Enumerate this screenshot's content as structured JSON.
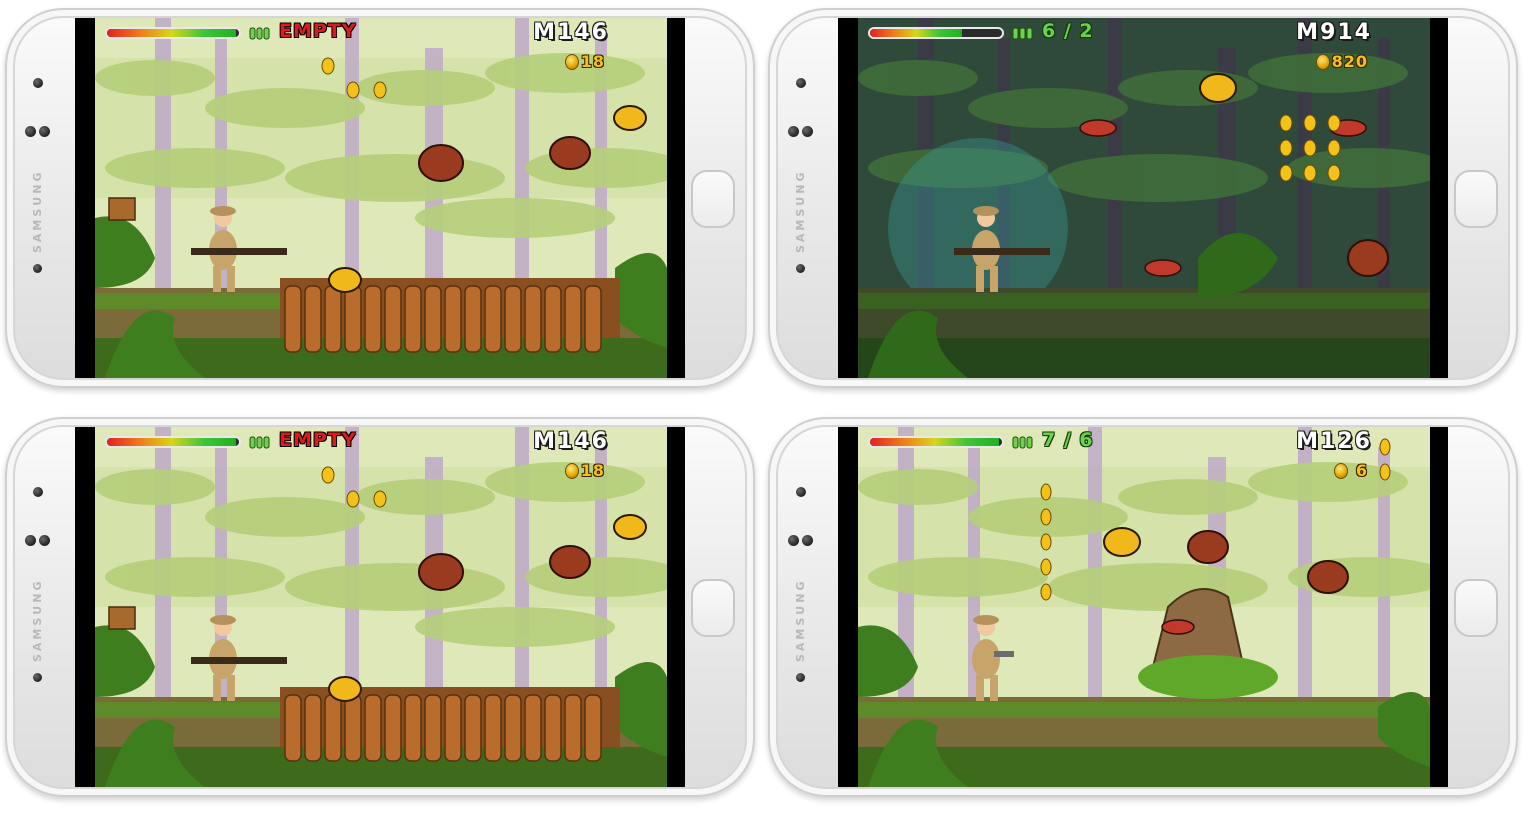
{
  "phones": [
    {
      "id": "top-left",
      "brand": "SAMSUNG",
      "hud": {
        "health_fraction": 0.98,
        "ammo_label": "EMPTY",
        "ammo_style": "empty",
        "distance": "M146",
        "coins": "18"
      },
      "theme": "day",
      "scene": "bridge"
    },
    {
      "id": "top-right",
      "brand": "SAMSUNG",
      "hud": {
        "health_fraction": 0.7,
        "ammo_label": "6 / 2",
        "ammo_style": "count",
        "distance": "M914",
        "coins": "820"
      },
      "theme": "night",
      "scene": "mosquitoes"
    },
    {
      "id": "bottom-left",
      "brand": "SAMSUNG",
      "hud": {
        "health_fraction": 0.98,
        "ammo_label": "EMPTY",
        "ammo_style": "empty",
        "distance": "M146",
        "coins": "18"
      },
      "theme": "day",
      "scene": "bridge"
    },
    {
      "id": "bottom-right",
      "brand": "SAMSUNG",
      "hud": {
        "health_fraction": 0.98,
        "ammo_label": "7 / 6",
        "ammo_style": "count",
        "distance": "M126",
        "coins": "6"
      },
      "theme": "day",
      "scene": "stump"
    }
  ],
  "colors": {
    "health_gradient": [
      "#e02222",
      "#f07a1a",
      "#d6d61a",
      "#3fc43a"
    ],
    "ammo_empty": "#e01a1a",
    "ammo_count": "#6bd24a",
    "coin": "#f2c21b",
    "sky_day": "#dfe8b8",
    "sky_night": "#2f4a3a"
  },
  "icons": [
    "bullet-icon",
    "coin-icon",
    "camera-icon",
    "home-button"
  ]
}
